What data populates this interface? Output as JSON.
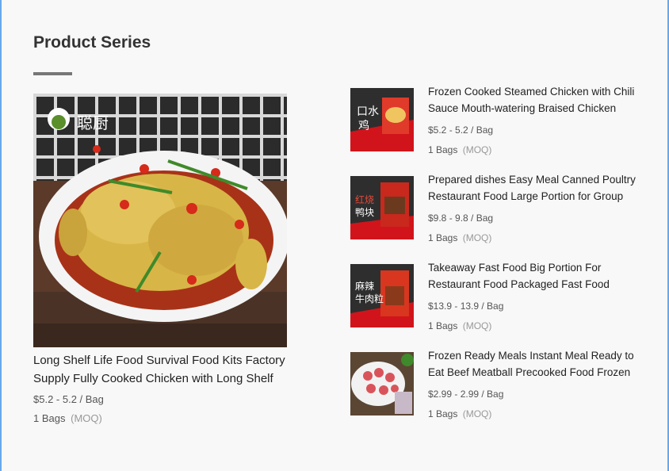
{
  "section": {
    "title": "Product Series"
  },
  "featured": {
    "name": "Long Shelf Life Food Survival Food Kits Factory Supply Fully Cooked Chicken with Long Shelf",
    "price": "$5.2 - 5.2 / Bag",
    "moq_value": "1 Bags",
    "moq_tag": "(MOQ)",
    "image": {
      "icon": "steamed-chicken-photo",
      "brand_text": "聪厨"
    }
  },
  "products": [
    {
      "name": "Frozen Cooked Steamed Chicken with Chili Sauce Mouth-watering Braised Chicken",
      "price": "$5.2 - 5.2 / Bag",
      "moq_value": "1 Bags",
      "moq_tag": "(MOQ)",
      "image_text": "口水鸡"
    },
    {
      "name": "Prepared dishes Easy Meal Canned Poultry Restaurant Food Large Portion for Group",
      "price": "$9.8 - 9.8 / Bag",
      "moq_value": "1 Bags",
      "moq_tag": "(MOQ)",
      "image_text": "红烧鸭块"
    },
    {
      "name": "Takeaway Fast Food Big Portion For Restaurant Food Packaged Fast Food",
      "price": "$13.9 - 13.9 / Bag",
      "moq_value": "1 Bags",
      "moq_tag": "(MOQ)",
      "image_text": "麻辣牛肉粒"
    },
    {
      "name": "Frozen Ready Meals Instant Meal Ready to Eat Beef Meatball Precooked Food Frozen",
      "price": "$2.99 - 2.99 / Bag",
      "moq_value": "1 Bags",
      "moq_tag": "(MOQ)",
      "image_text": ""
    }
  ]
}
